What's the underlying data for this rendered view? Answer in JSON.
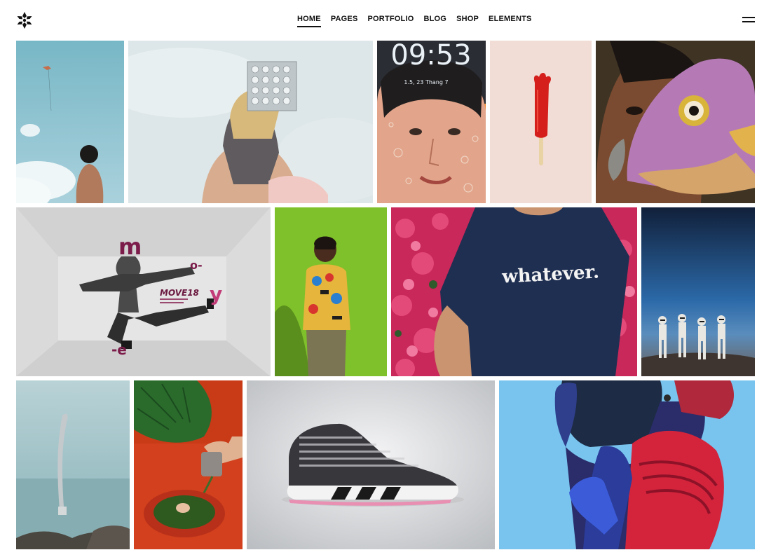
{
  "header": {
    "logo_icon": "snowflake-logo-icon",
    "nav": [
      {
        "label": "HOME",
        "active": true
      },
      {
        "label": "PAGES",
        "active": false
      },
      {
        "label": "PORTFOLIO",
        "active": false
      },
      {
        "label": "BLOG",
        "active": false
      },
      {
        "label": "SHOP",
        "active": false
      },
      {
        "label": "ELEMENTS",
        "active": false
      }
    ],
    "menu_icon": "hamburger-menu-icon"
  },
  "gallery": {
    "phone_clock": "09:53",
    "phone_date": "1.5, 23 Thang 7",
    "poster_title": "MOVE18",
    "poster_letters": [
      "m",
      "o-",
      "y",
      "-e"
    ],
    "tshirt_text": "whatever."
  }
}
